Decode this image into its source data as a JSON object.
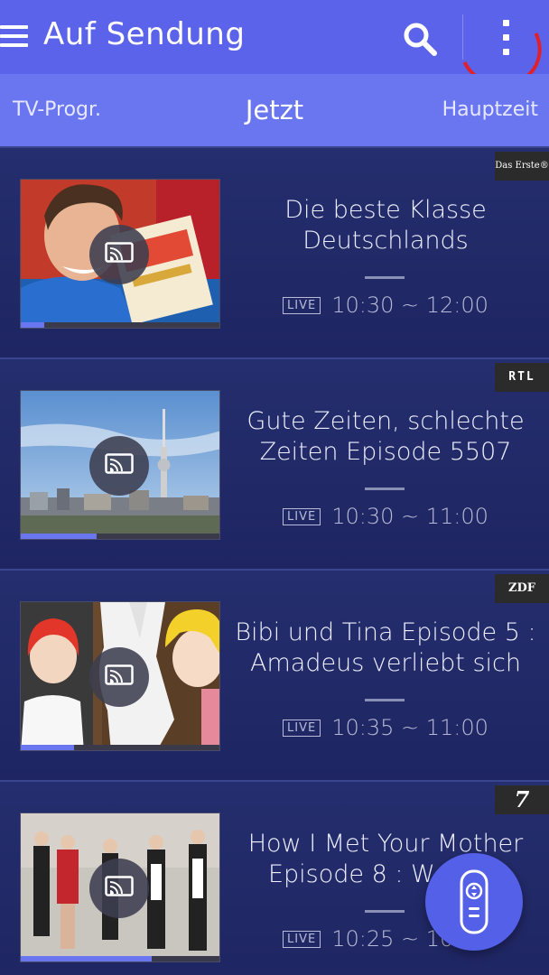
{
  "app": {
    "title": "Auf Sendung"
  },
  "tabs": {
    "left": "TV-Progr.",
    "center": "Jetzt",
    "right": "Hauptzeit"
  },
  "colors": {
    "appbar": "#5b63ea",
    "tabbar": "#6a75f0",
    "background": "#1f2660",
    "accent": "#6a75f0"
  },
  "programs": [
    {
      "channel": "Das Erste®",
      "title": "Die beste Klasse Deutschlands",
      "live": "LIVE",
      "time": "10:30 ~ 12:00",
      "progress": 0.12
    },
    {
      "channel": "RTL",
      "title": "Gute Zeiten, schlechte Zeiten Episode 5507",
      "live": "LIVE",
      "time": "10:30 ~ 11:00",
      "progress": 0.38
    },
    {
      "channel": "ZDF",
      "title": "Bibi und Tina Episode 5 : Amadeus verliebt sich",
      "live": "LIVE",
      "time": "10:35 ~ 11:00",
      "progress": 0.27
    },
    {
      "channel": "7",
      "title": "How I Met Your Mother Episode 8 : Woooo!",
      "live": "LIVE",
      "time": "10:25 ~ 10:50",
      "progress": 0.66
    }
  ],
  "icons": {
    "menu": "menu-icon",
    "search": "search-icon",
    "more": "more-vert-icon",
    "cast": "cast-icon",
    "remote": "remote-icon"
  }
}
